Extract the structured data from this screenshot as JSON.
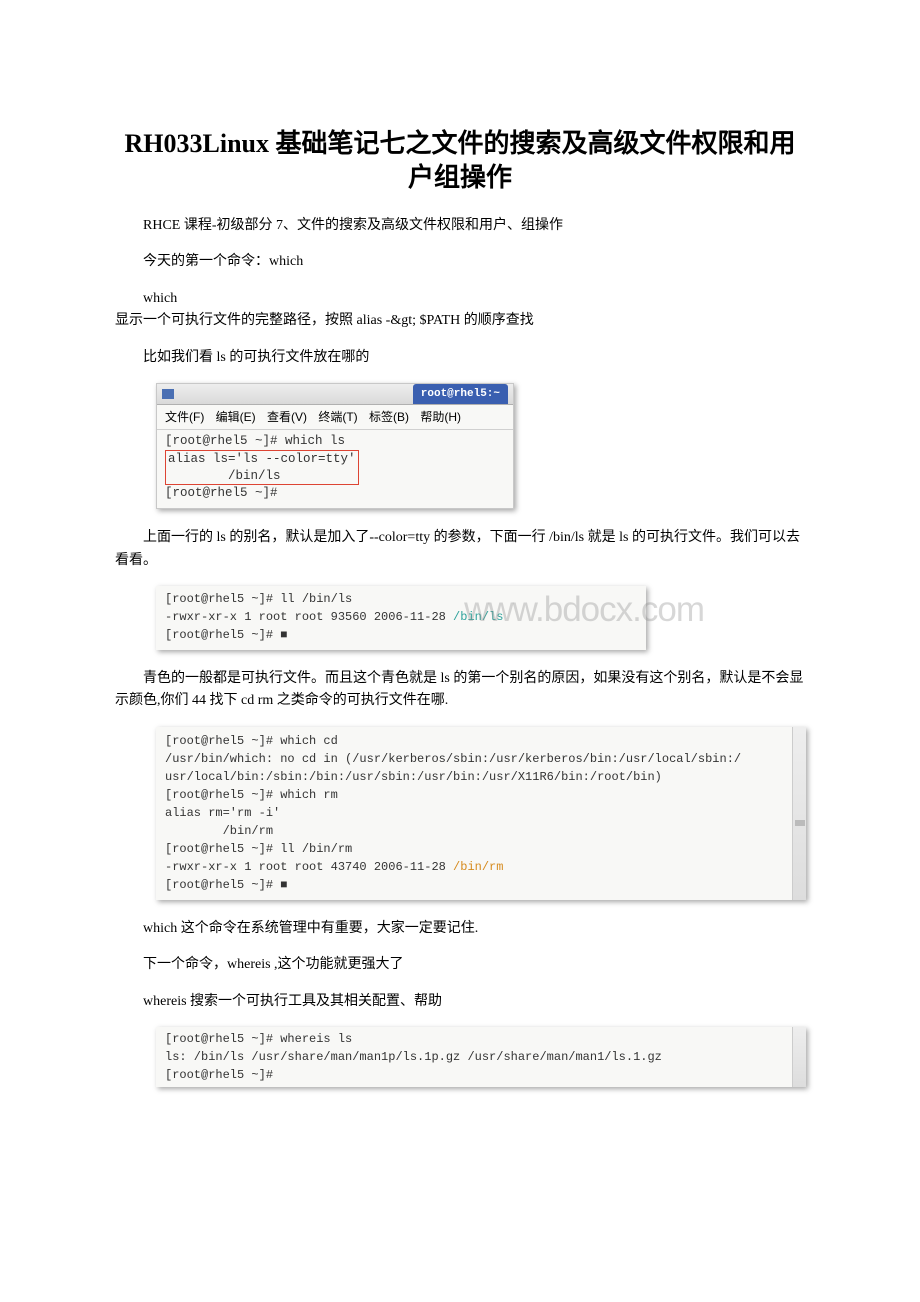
{
  "title": "RH033Linux 基础笔记七之文件的搜索及高级文件权限和用户组操作",
  "p1": "RHCE 课程-初级部分 7、文件的搜索及高级文件权限和用户、组操作",
  "p2": "今天的第一个命令：which",
  "p3line1": "which",
  "p3line2": "显示一个可执行文件的完整路径，按照 alias -&gt; $PATH 的顺序查找",
  "p4": "比如我们看 ls 的可执行文件放在哪的",
  "fig1": {
    "titlebar": "root@rhel5:~",
    "menu": {
      "file": "文件(F)",
      "edit": "编辑(E)",
      "view": "查看(V)",
      "term": "终端(T)",
      "tab": "标签(B)",
      "help": "帮助(H)"
    },
    "l1": "[root@rhel5 ~]# which ls",
    "l2a": "alias ls='ls --color=tty'",
    "l2b": "        /bin/ls",
    "l3": "[root@rhel5 ~]#"
  },
  "p5": "上面一行的 ls 的别名，默认是加入了--color=tty 的参数，下面一行 /bin/ls 就是 ls 的可执行文件。我们可以去看看。",
  "fig2": {
    "wm": "www.bdocx.com",
    "l1": "[root@rhel5 ~]# ll /bin/ls",
    "l2a": "-rwxr-xr-x 1 root root 93560 2006-11-28 ",
    "l2b": "/bin/ls",
    "l3": "[root@rhel5 ~]# ■"
  },
  "p6": "青色的一般都是可执行文件。而且这个青色就是 ls 的第一个别名的原因，如果没有这个别名，默认是不会显示颜色,你们 44 找下 cd rm 之类命令的可执行文件在哪.",
  "fig3": {
    "l1": "[root@rhel5 ~]# which cd",
    "l2": "/usr/bin/which: no cd in (/usr/kerberos/sbin:/usr/kerberos/bin:/usr/local/sbin:/",
    "l3": "usr/local/bin:/sbin:/bin:/usr/sbin:/usr/bin:/usr/X11R6/bin:/root/bin)",
    "l4": "[root@rhel5 ~]# which rm",
    "l5": "alias rm='rm -i'",
    "l6": "        /bin/rm",
    "l7": "[root@rhel5 ~]# ll /bin/rm",
    "l8a": "-rwxr-xr-x 1 root root 43740 2006-11-28 ",
    "l8b": "/bin/rm",
    "l9": "[root@rhel5 ~]# ■"
  },
  "p7": "which 这个命令在系统管理中有重要，大家一定要记住.",
  "p8": "下一个命令，whereis ,这个功能就更强大了",
  "p9": "whereis 搜索一个可执行工具及其相关配置、帮助",
  "fig4": {
    "l1": "[root@rhel5 ~]# whereis ls",
    "l2": "ls: /bin/ls /usr/share/man/man1p/ls.1p.gz /usr/share/man/man1/ls.1.gz",
    "l3": "[root@rhel5 ~]#"
  }
}
